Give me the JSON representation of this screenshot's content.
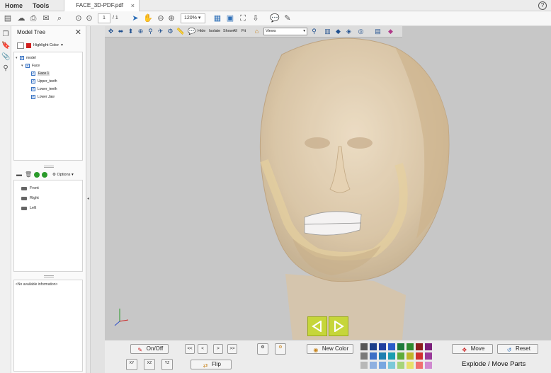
{
  "menubar": {
    "home": "Home",
    "tools": "Tools",
    "doc_tab": "FACE_3D-PDF.pdf",
    "doc_tab_close": "×",
    "help": "?"
  },
  "toolbar": {
    "page_current": "1",
    "page_total": "/ 1",
    "zoom": "120%"
  },
  "model_tree": {
    "title": "Model Tree",
    "highlight_label": "Highlight Color",
    "highlight_color": "#d0201f",
    "items": [
      {
        "label": "model",
        "level": 0
      },
      {
        "label": "Face",
        "level": 1
      },
      {
        "label": "Face 1",
        "level": 2,
        "selected": true
      },
      {
        "label": "Upper_teeth",
        "level": 2
      },
      {
        "label": "Lower_teeth",
        "level": 2
      },
      {
        "label": "Lower Jaw",
        "level": 2
      }
    ],
    "options_label": "Options",
    "views": [
      "Front",
      "Right",
      "Left"
    ],
    "info_text": "<No available information>"
  },
  "viewer": {
    "hide": "Hide",
    "isolate": "Isolate",
    "show_all": "ShowAll",
    "fit": "Fit",
    "views_select": "Views"
  },
  "controls": {
    "on_off": "On/Off",
    "first": "<<",
    "prev": "<",
    "next": ">",
    "last": ">>",
    "new_color": "New Color",
    "move": "Move",
    "reset": "Reset",
    "flip": "Flip",
    "axis_xy": "XY",
    "axis_xz": "XZ",
    "axis_yz": "YZ",
    "explode_label": "Explode / Move Parts",
    "palette": [
      "#555555",
      "#1b3f8a",
      "#1f3fa0",
      "#2a5cc9",
      "#1d7a3a",
      "#2e8b2e",
      "#8c1e1e",
      "#7b1f7b",
      "#7a7a7a",
      "#3d6fc6",
      "#1e7fb0",
      "#1b9db0",
      "#5eab3a",
      "#c0b52a",
      "#d03030",
      "#9a3a9a",
      "#b8b8b8",
      "#8fb0e0",
      "#7aa7e0",
      "#7cc8d8",
      "#a6d47a",
      "#e8e06a",
      "#f07070",
      "#d08ad0"
    ]
  }
}
